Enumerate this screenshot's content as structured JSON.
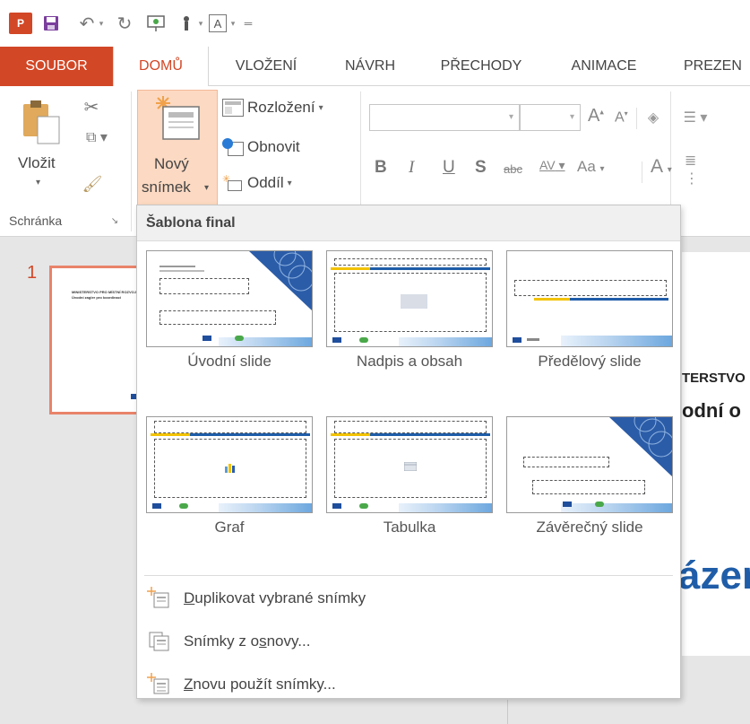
{
  "app": {
    "logo": "P",
    "qat_font_box": "A"
  },
  "tabs": [
    {
      "label": "SOUBOR"
    },
    {
      "label": "DOMŮ"
    },
    {
      "label": "VLOŽENÍ"
    },
    {
      "label": "NÁVRH"
    },
    {
      "label": "PŘECHODY"
    },
    {
      "label": "ANIMACE"
    },
    {
      "label": "PREZEN"
    }
  ],
  "ribbon": {
    "paste_label": "Vložit",
    "new_slide_label_1": "Nový",
    "new_slide_label_2": "snímek",
    "layout_label": "Rozložení",
    "reset_label": "Obnovit",
    "section_label": "Oddíl",
    "clipboard_group": "Schránka",
    "font_buttons": [
      "B",
      "I",
      "U",
      "S",
      "abc",
      "AV",
      "Aa",
      "A"
    ],
    "grow_font": "A",
    "shrink_font": "A"
  },
  "slide_panel": {
    "slide_number": "1",
    "thumb_line_1": "MINISTERSTVO PRO MÍSTNÍ ROZVOJ",
    "thumb_line_2": "Úvodní zagler pro koordinaci"
  },
  "slide_canvas": {
    "text_1": "TERSTVO",
    "text_2": "odní o",
    "text_3": "ázen"
  },
  "dropdown": {
    "header": "Šablona final",
    "layouts": [
      {
        "label": "Úvodní slide"
      },
      {
        "label": "Nadpis a obsah"
      },
      {
        "label": "Předělový slide"
      },
      {
        "label": "Graf"
      },
      {
        "label": "Tabulka"
      },
      {
        "label": "Závěrečný slide"
      }
    ],
    "menu_items": [
      {
        "pre": "",
        "key": "D",
        "post": "uplikovat vybrané snímky"
      },
      {
        "pre": "Snímky z o",
        "key": "s",
        "post": "novy..."
      },
      {
        "pre": "",
        "key": "Z",
        "post": "novu použít snímky..."
      }
    ]
  },
  "colors": {
    "accent": "#d24726",
    "brand_blue": "#1f5da8",
    "brand_yellow": "#f2c200",
    "hover": "#fcd9c2"
  }
}
